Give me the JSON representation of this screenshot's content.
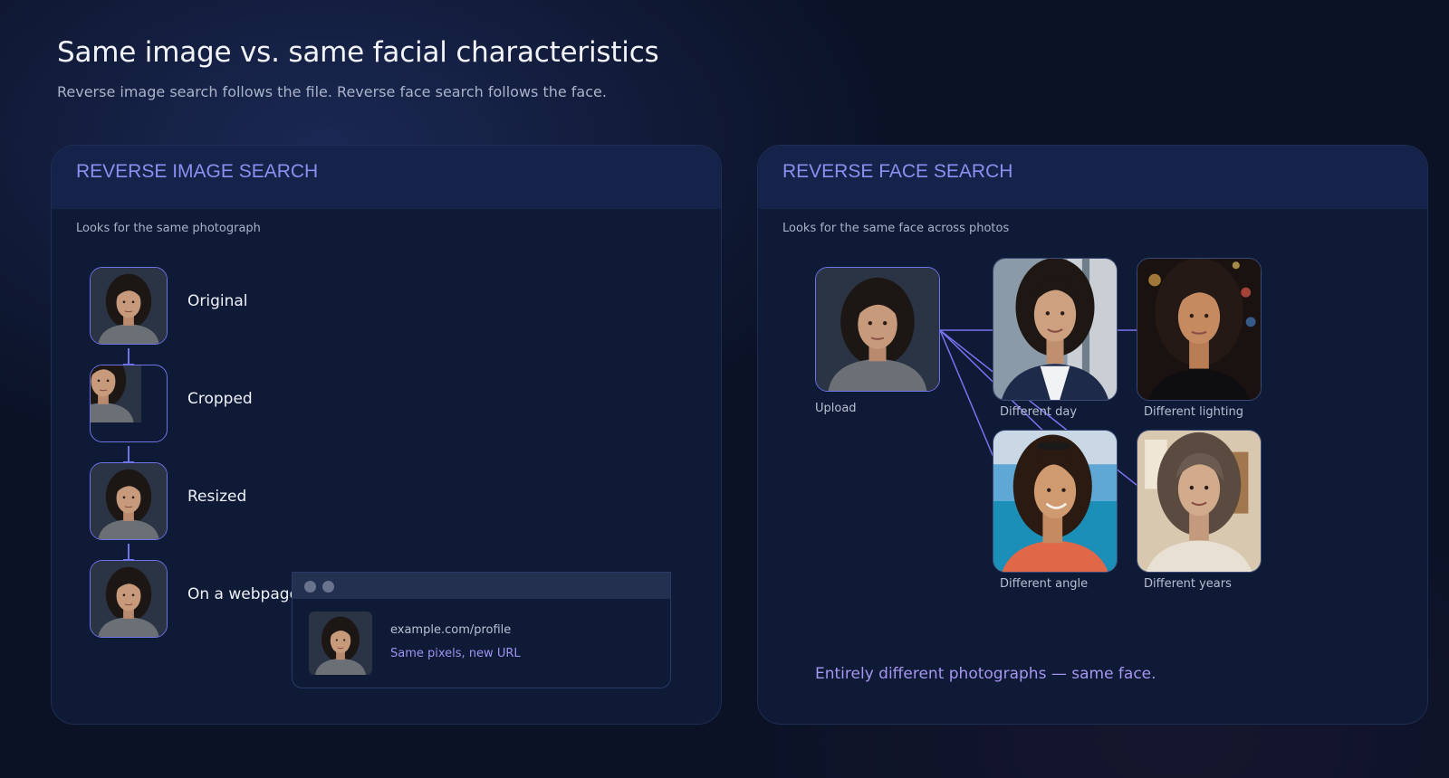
{
  "header": {
    "title": "Same image vs. same facial characteristics",
    "subtitle": "Reverse image search follows the file. Reverse face search follows the face."
  },
  "left_panel": {
    "title": "REVERSE IMAGE SEARCH",
    "subtitle": "Looks for the same photograph",
    "steps": [
      {
        "label": "Original"
      },
      {
        "label": "Cropped"
      },
      {
        "label": "Resized"
      },
      {
        "label": "On a webpage"
      }
    ],
    "browser": {
      "url": "example.com/profile",
      "note": "Same pixels, new URL"
    }
  },
  "right_panel": {
    "title": "REVERSE FACE SEARCH",
    "subtitle": "Looks for the same face across photos",
    "upload_label": "Upload",
    "matches": [
      {
        "label": "Different day"
      },
      {
        "label": "Different lighting"
      },
      {
        "label": "Different angle"
      },
      {
        "label": "Different years"
      }
    ],
    "footer": "Entirely different photographs — same face."
  },
  "colors": {
    "accent": "#8c8ff0",
    "link_line": "#7a72f0",
    "panel_bg": "#0f1a36",
    "panel_head_bg": "#15224a",
    "background": "#0b1226"
  }
}
